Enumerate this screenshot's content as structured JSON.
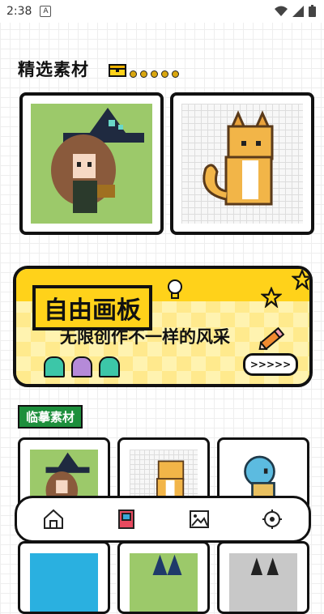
{
  "status_bar": {
    "time": "2:38",
    "app_badge": "A"
  },
  "featured": {
    "title": "精选素材"
  },
  "banner": {
    "title": "自由画板",
    "subtitle": "无限创作不一样的风采",
    "button_label": ">>>>>"
  },
  "copy_section": {
    "title": "临摹素材"
  },
  "nav": {
    "items": [
      "home-icon",
      "book-icon",
      "gallery-icon",
      "settings-icon"
    ]
  },
  "colors": {
    "accent_yellow": "#ffd21a",
    "accent_green": "#1d8f3c",
    "border": "#111111"
  }
}
